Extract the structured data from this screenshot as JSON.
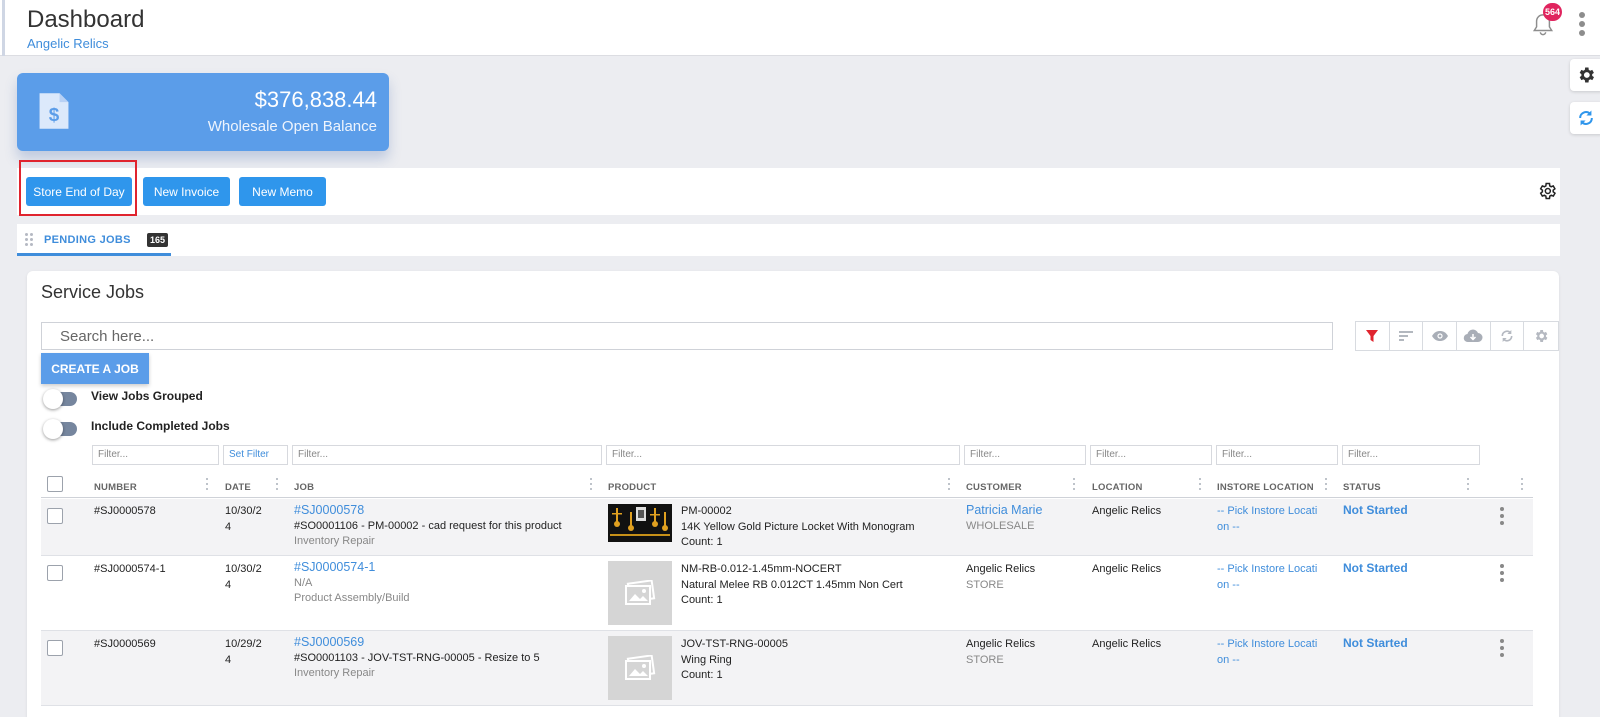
{
  "header": {
    "title": "Dashboard",
    "subtitle": "Angelic Relics",
    "notification_count": "564"
  },
  "balance": {
    "amount": "$376,838.44",
    "label": "Wholesale Open Balance",
    "icon": "invoice-dollar-icon"
  },
  "actions": {
    "store_end_of_day": "Store End of Day",
    "new_invoice": "New Invoice",
    "new_memo": "New Memo"
  },
  "tabs": [
    {
      "label": "PENDING JOBS",
      "count": "165"
    }
  ],
  "panel": {
    "title": "Service Jobs",
    "search_placeholder": "Search here...",
    "create_button": "CREATE A JOB",
    "toggle_grouped": "View Jobs Grouped",
    "toggle_completed": "Include Completed Jobs"
  },
  "filters": {
    "number": "Filter...",
    "date": "Set Filter",
    "job": "Filter...",
    "product": "Filter...",
    "customer": "Filter...",
    "location": "Filter...",
    "instore_location": "Filter...",
    "status": "Filter..."
  },
  "columns": {
    "number": "NUMBER",
    "date": "DATE",
    "job": "JOB",
    "product": "PRODUCT",
    "customer": "CUSTOMER",
    "location": "LOCATION",
    "instore_location": "INSTORE LOCATION",
    "status": "STATUS"
  },
  "rows": [
    {
      "number": "#SJ0000578",
      "date_line1": "10/30/2",
      "date_line2": "4",
      "job_link": "#SJ0000578",
      "job_desc": "#SO0001106 - PM-00002 - cad request for this product",
      "job_type": "Inventory Repair",
      "product_sku": "PM-00002",
      "product_name": "14K Yellow Gold Picture Locket With Monogram",
      "product_count": "Count: 1",
      "customer": "Patricia Marie",
      "customer_type": "WHOLESALE",
      "location": "Angelic Relics",
      "instore_line1": "-- Pick Instore Locati",
      "instore_line2": "on --",
      "status": "Not Started"
    },
    {
      "number": "#SJ0000574-1",
      "date_line1": "10/30/2",
      "date_line2": "4",
      "job_link": "#SJ0000574-1",
      "job_desc": "N/A",
      "job_type": "Product Assembly/Build",
      "product_sku": "NM-RB-0.012-1.45mm-NOCERT",
      "product_name": "Natural Melee RB 0.012CT 1.45mm Non Cert",
      "product_count": "Count: 1",
      "customer": "Angelic Relics",
      "customer_type": "STORE",
      "location": "Angelic Relics",
      "instore_line1": "-- Pick Instore Locati",
      "instore_line2": "on --",
      "status": "Not Started"
    },
    {
      "number": "#SJ0000569",
      "date_line1": "10/29/2",
      "date_line2": "4",
      "job_link": "#SJ0000569",
      "job_desc": "#SO0001103 - JOV-TST-RNG-00005 - Resize to 5",
      "job_type": "Inventory Repair",
      "product_sku": "JOV-TST-RNG-00005",
      "product_name": "Wing Ring",
      "product_count": "Count: 1",
      "customer": "Angelic Relics",
      "customer_type": "STORE",
      "location": "Angelic Relics",
      "instore_line1": "-- Pick Instore Locati",
      "instore_line2": "on --",
      "status": "Not Started"
    }
  ],
  "icons": {
    "bell": "bell-icon",
    "kebab": "more-vertical-icon",
    "settings": "gear-icon",
    "sync": "sync-icon",
    "filter": "filter-icon",
    "sort": "sort-icon",
    "eye": "eye-icon",
    "download": "cloud-download-icon",
    "refresh": "refresh-icon",
    "image_placeholder": "image-placeholder-icon"
  },
  "colors": {
    "primary": "#2f96ec",
    "card": "#5b9de9",
    "link": "#3f8ddb",
    "badge": "#e0245e",
    "highlight": "#e0242e",
    "filter_active": "#e0242e"
  }
}
